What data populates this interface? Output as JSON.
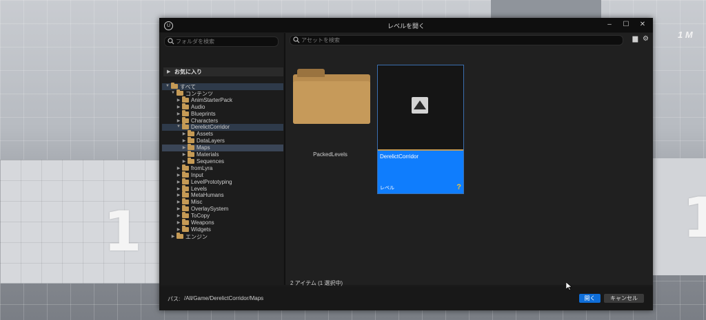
{
  "viewport": {
    "left_number": "1",
    "right_number": "1",
    "top_label": "1 M"
  },
  "dialog": {
    "title": "レベルを開く",
    "window_buttons": [
      "–",
      "☐",
      "✕"
    ],
    "folder_search": {
      "placeholder": "フォルダを検索"
    },
    "asset_search": {
      "placeholder": "アセットを検索"
    },
    "favorites_label": "お気に入り",
    "tree": [
      {
        "label": "すべて",
        "depth": 0,
        "expanded": true
      },
      {
        "label": "コンテンツ",
        "depth": 1,
        "expanded": true
      },
      {
        "label": "AnimStarterPack",
        "depth": 2
      },
      {
        "label": "Audio",
        "depth": 2
      },
      {
        "label": "Blueprints",
        "depth": 2
      },
      {
        "label": "Characters",
        "depth": 2
      },
      {
        "label": "DerelictCorridor",
        "depth": 2,
        "expanded": true
      },
      {
        "label": "Assets",
        "depth": 3
      },
      {
        "label": "DataLayers",
        "depth": 3
      },
      {
        "label": "Maps",
        "depth": 3,
        "selected": true
      },
      {
        "label": "Materials",
        "depth": 3
      },
      {
        "label": "Sequences",
        "depth": 3
      },
      {
        "label": "fromLyra",
        "depth": 2
      },
      {
        "label": "Input",
        "depth": 2
      },
      {
        "label": "LevelPrototyping",
        "depth": 2
      },
      {
        "label": "Levels",
        "depth": 2
      },
      {
        "label": "MetaHumans",
        "depth": 2
      },
      {
        "label": "Misc",
        "depth": 2
      },
      {
        "label": "OverlaySystem",
        "depth": 2
      },
      {
        "label": "ToCopy",
        "depth": 2
      },
      {
        "label": "Weapons",
        "depth": 2
      },
      {
        "label": "Widgets",
        "depth": 2
      },
      {
        "label": "エンジン",
        "depth": 1
      }
    ],
    "assets": [
      {
        "name": "PackedLevels",
        "kind": "folder"
      },
      {
        "name": "DerelictCorridor",
        "kind": "level",
        "type_label": "レベル",
        "selected": true
      }
    ],
    "item_count": "2 アイテム (1 選択中)",
    "path_label": "パス:",
    "path_value": "/All/Game/DerelictCorridor/Maps",
    "open_label": "開く",
    "cancel_label": "キャンセル"
  },
  "colors": {
    "accent": "#0f7dfd",
    "folder": "#c69a5a",
    "panel_bg": "#1c1c1c"
  }
}
